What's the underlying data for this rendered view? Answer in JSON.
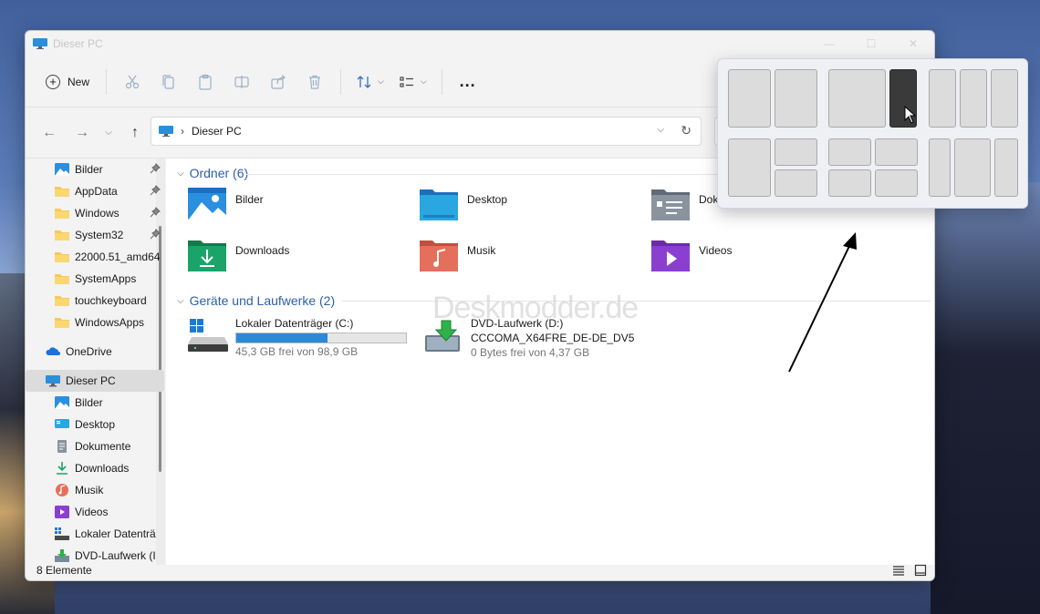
{
  "window": {
    "title": "Dieser PC"
  },
  "toolbar": {
    "new_label": "New",
    "more_label": "..."
  },
  "address": {
    "location": "Dieser PC"
  },
  "sidebar": {
    "quick_access": [
      {
        "label": "Bilder",
        "pinned": true,
        "icon": "pictures-icon"
      },
      {
        "label": "AppData",
        "pinned": true,
        "icon": "folder-icon"
      },
      {
        "label": "Windows",
        "pinned": true,
        "icon": "folder-icon"
      },
      {
        "label": "System32",
        "pinned": true,
        "icon": "folder-icon"
      },
      {
        "label": "22000.51_amd64",
        "pinned": false,
        "icon": "folder-icon"
      },
      {
        "label": "SystemApps",
        "pinned": false,
        "icon": "folder-icon"
      },
      {
        "label": "touchkeyboard",
        "pinned": false,
        "icon": "folder-icon"
      },
      {
        "label": "WindowsApps",
        "pinned": false,
        "icon": "folder-icon"
      }
    ],
    "onedrive": "OneDrive",
    "this_pc": "Dieser PC",
    "this_pc_children": [
      {
        "label": "Bilder",
        "icon": "pictures-icon"
      },
      {
        "label": "Desktop",
        "icon": "desktop-icon"
      },
      {
        "label": "Dokumente",
        "icon": "documents-icon"
      },
      {
        "label": "Downloads",
        "icon": "downloads-icon"
      },
      {
        "label": "Musik",
        "icon": "music-icon"
      },
      {
        "label": "Videos",
        "icon": "videos-icon"
      },
      {
        "label": "Lokaler Datenträ",
        "icon": "drive-icon"
      },
      {
        "label": "DVD-Laufwerk (I",
        "icon": "dvd-icon"
      }
    ]
  },
  "groups": {
    "folders_title": "Ordner (6)",
    "drives_title": "Geräte und Laufwerke (2)"
  },
  "folders": [
    {
      "label": "Bilder",
      "icon": "pictures-icon"
    },
    {
      "label": "Desktop",
      "icon": "desktop-icon"
    },
    {
      "label": "Dok",
      "icon": "documents-icon"
    },
    {
      "label": "Downloads",
      "icon": "downloads-icon"
    },
    {
      "label": "Musik",
      "icon": "music-icon"
    },
    {
      "label": "Videos",
      "icon": "videos-icon"
    }
  ],
  "drives": [
    {
      "name": "Lokaler Datenträger (C:)",
      "free": "45,3 GB frei von 98,9 GB",
      "used_fraction": 0.54,
      "icon": "windows-drive-icon"
    },
    {
      "name": "DVD-Laufwerk (D:)",
      "sub": "CCCOMA_X64FRE_DE-DE_DV5",
      "free": "0 Bytes frei von 4,37 GB",
      "icon": "dvd-drive-icon"
    }
  ],
  "status": {
    "count": "8 Elemente"
  },
  "watermark": "Deskmodder.de",
  "colors": {
    "accent": "#2d89d6",
    "group_heading": "#2c5fa8",
    "snap_active": "#3a3a3a"
  }
}
